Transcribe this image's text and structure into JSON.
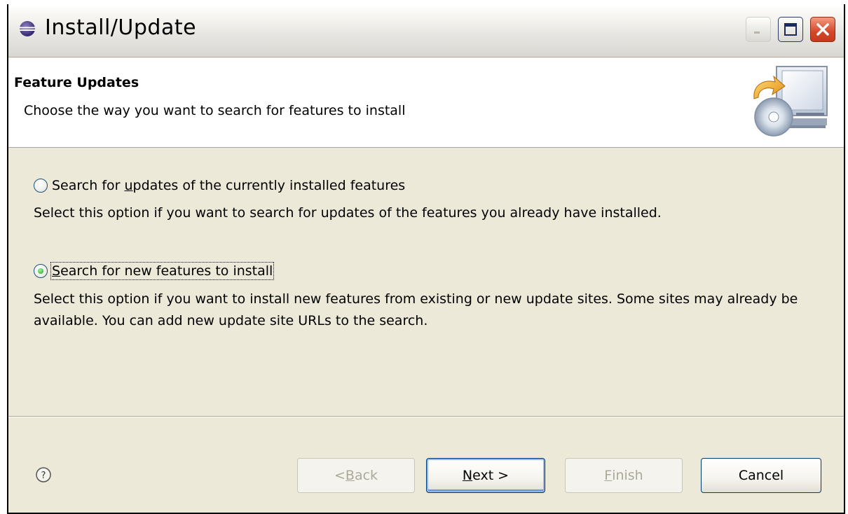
{
  "window": {
    "title": "Install/Update"
  },
  "banner": {
    "title": "Feature Updates",
    "description": "Choose the way you want to search for features to install"
  },
  "options": [
    {
      "pre": "Search for ",
      "accel": "u",
      "post": "pdates of the currently installed features",
      "description": "Select this option if you want to search for updates of the features you already have installed.",
      "checked": false
    },
    {
      "pre": "",
      "accel": "S",
      "post": "earch for new features to install",
      "description": "Select this option if you want to install new features from existing or new update sites. Some sites may already be available. You can add new update site URLs to the search.",
      "checked": true
    }
  ],
  "buttons": {
    "back": {
      "pre": "< ",
      "accel": "B",
      "post": "ack",
      "enabled": false
    },
    "next": {
      "pre": "",
      "accel": "N",
      "post": "ext >",
      "enabled": true
    },
    "finish": {
      "pre": "",
      "accel": "F",
      "post": "inish",
      "enabled": false
    },
    "cancel": {
      "label": "Cancel",
      "enabled": true
    }
  },
  "icons": {
    "title": "eclipse-icon",
    "banner": "install-update-wizard-icon",
    "help": "help-icon"
  },
  "colors": {
    "button_border": "#003c74",
    "disabled_text": "#aca899",
    "close_red": "#d5482a"
  }
}
